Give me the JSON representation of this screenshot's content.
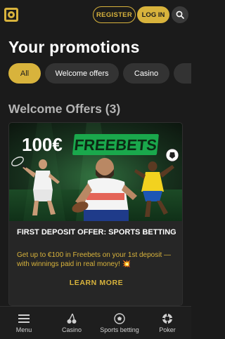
{
  "header": {
    "register_label": "REGISTER",
    "login_label": "LOG IN",
    "logo_icon": "logo-icon",
    "search_icon": "search-icon"
  },
  "page_title": "Your promotions",
  "filters": [
    {
      "label": "All",
      "active": true
    },
    {
      "label": "Welcome offers",
      "active": false
    },
    {
      "label": "Casino",
      "active": false
    },
    {
      "label": "",
      "active": false
    }
  ],
  "section": {
    "title": "Welcome Offers (3)"
  },
  "offer_card": {
    "banner_amount": "100€",
    "banner_tag": "FREEBETS",
    "title": "FIRST DEPOSIT OFFER: SPORTS BETTING",
    "description": "Get up to €100 in Freebets on your 1st deposit — with winnings paid in real money! 💥",
    "cta_label": "LEARN MORE"
  },
  "bottom_nav": [
    {
      "label": "Menu",
      "icon": "menu-icon"
    },
    {
      "label": "Casino",
      "icon": "cherries-icon"
    },
    {
      "label": "Sports betting",
      "icon": "soccer-ball-icon"
    },
    {
      "label": "Poker",
      "icon": "poker-chip-icon"
    }
  ],
  "colors": {
    "background": "#1b1b1b",
    "accent": "#d8b33c",
    "chip": "#333333",
    "card": "#262626",
    "banner_green": "#1aa84c"
  }
}
